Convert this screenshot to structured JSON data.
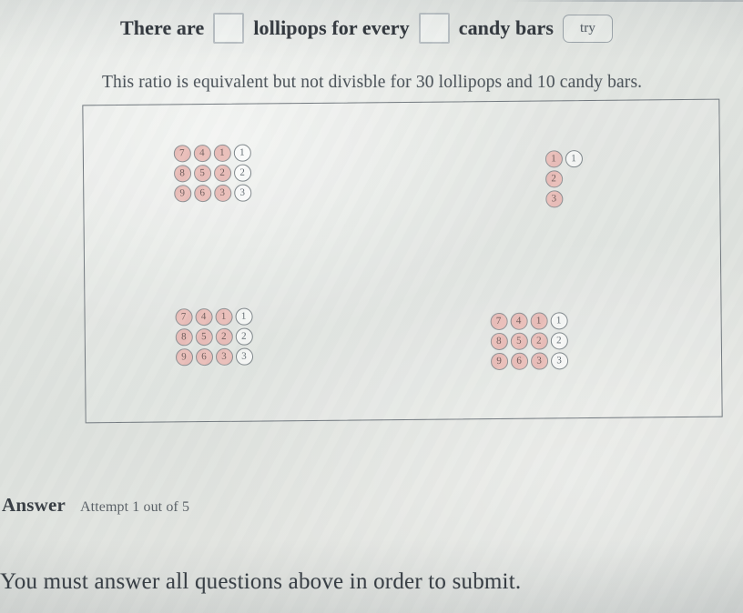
{
  "question": {
    "prompt_part1": "There are",
    "prompt_part2": "lollipops for every",
    "prompt_part3": "candy bars",
    "input1_value": "",
    "input2_value": "",
    "try_button_label": "try",
    "subtitle": "This ratio is equivalent but not divisble for 30 lollipops and 10 candy bars."
  },
  "diagram": {
    "groups": [
      {
        "name": "top-left-grid",
        "rows": [
          [
            {
              "label": "7",
              "state": "filled"
            },
            {
              "label": "4",
              "state": "filled"
            },
            {
              "label": "1",
              "state": "filled"
            },
            {
              "label": "1",
              "state": "empty"
            }
          ],
          [
            {
              "label": "8",
              "state": "filled"
            },
            {
              "label": "5",
              "state": "filled"
            },
            {
              "label": "2",
              "state": "filled"
            },
            {
              "label": "2",
              "state": "empty"
            }
          ],
          [
            {
              "label": "9",
              "state": "filled"
            },
            {
              "label": "6",
              "state": "filled"
            },
            {
              "label": "3",
              "state": "filled"
            },
            {
              "label": "3",
              "state": "empty"
            }
          ]
        ]
      },
      {
        "name": "top-right-column",
        "rows": [
          [
            {
              "label": "1",
              "state": "filled"
            },
            {
              "label": "1",
              "state": "empty"
            }
          ],
          [
            {
              "label": "2",
              "state": "filled"
            },
            {
              "label": "",
              "state": "hidden"
            }
          ],
          [
            {
              "label": "3",
              "state": "filled"
            },
            {
              "label": "",
              "state": "hidden"
            }
          ]
        ]
      },
      {
        "name": "bottom-left-grid",
        "rows": [
          [
            {
              "label": "7",
              "state": "filled"
            },
            {
              "label": "4",
              "state": "filled"
            },
            {
              "label": "1",
              "state": "filled"
            },
            {
              "label": "1",
              "state": "empty"
            }
          ],
          [
            {
              "label": "8",
              "state": "filled"
            },
            {
              "label": "5",
              "state": "filled"
            },
            {
              "label": "2",
              "state": "filled"
            },
            {
              "label": "2",
              "state": "empty"
            }
          ],
          [
            {
              "label": "9",
              "state": "filled"
            },
            {
              "label": "6",
              "state": "filled"
            },
            {
              "label": "3",
              "state": "filled"
            },
            {
              "label": "3",
              "state": "empty"
            }
          ]
        ]
      },
      {
        "name": "bottom-right-grid",
        "rows": [
          [
            {
              "label": "7",
              "state": "filled"
            },
            {
              "label": "4",
              "state": "filled"
            },
            {
              "label": "1",
              "state": "filled"
            },
            {
              "label": "1",
              "state": "empty"
            }
          ],
          [
            {
              "label": "8",
              "state": "filled"
            },
            {
              "label": "5",
              "state": "filled"
            },
            {
              "label": "2",
              "state": "filled"
            },
            {
              "label": "2",
              "state": "empty"
            }
          ],
          [
            {
              "label": "9",
              "state": "filled"
            },
            {
              "label": "6",
              "state": "filled"
            },
            {
              "label": "3",
              "state": "filled"
            },
            {
              "label": "3",
              "state": "empty"
            }
          ]
        ]
      }
    ]
  },
  "answer": {
    "label": "Answer",
    "attempt_text": "Attempt 1 out of 5"
  },
  "footer": {
    "submit_note": "You must answer all questions above in order to submit."
  },
  "colors": {
    "filled_dot": "#e9bdb8",
    "dot_border": "#8c8f92",
    "frame_border": "#6f767c",
    "page_background": "#e3e6e2",
    "text": "#2e3338"
  }
}
